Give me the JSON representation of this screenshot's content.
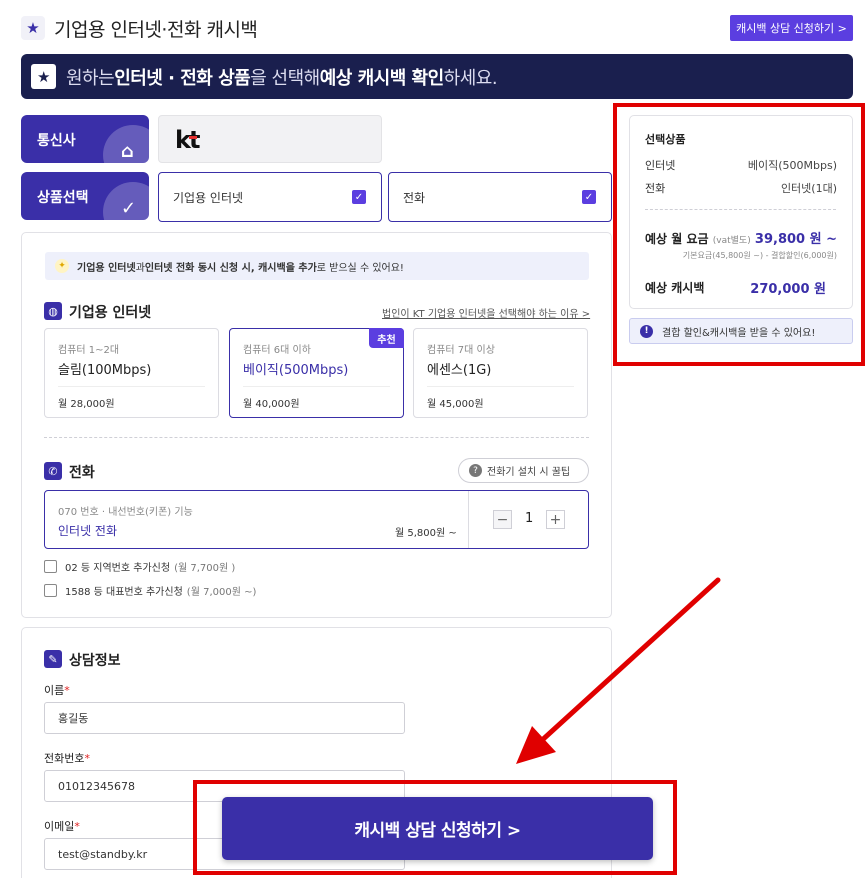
{
  "header": {
    "title": "기업용 인터넷·전화 캐시백",
    "consult_button": "캐시백 상담 신청하기 >"
  },
  "banner": {
    "part1": "원하는 ",
    "part2": "인터넷 · 전화 상품",
    "part3": "을 선택해 ",
    "part4": "예상 캐시백 확인",
    "part5": "하세요."
  },
  "carrier": {
    "label": "통신사",
    "value": "kt"
  },
  "product_select": {
    "label": "상품선택",
    "options": [
      {
        "label": "기업용 인터넷",
        "checked": true
      },
      {
        "label": "전화",
        "checked": true
      }
    ]
  },
  "tip": {
    "b1": "기업용 인터넷",
    "t1": "과 ",
    "b2": "인터넷 전화 동시 신청 시, 캐시백을 추가",
    "t2": "로 받으실 수 있어요!"
  },
  "internet": {
    "title": "기업용 인터넷",
    "link": "법인이 KT 기업용 인터넷을 선택해야 하는 이유 >",
    "plans": [
      {
        "sub": "컴퓨터 1~2대",
        "name": "슬림(100Mbps)",
        "price": "월 28,000원",
        "selected": false
      },
      {
        "sub": "컴퓨터 6대 이하",
        "name": "베이직(500Mbps)",
        "price": "월 40,000원",
        "selected": true,
        "badge": "추천"
      },
      {
        "sub": "컴퓨터 7대 이상",
        "name": "에센스(1G)",
        "price": "월 45,000원",
        "selected": false
      }
    ]
  },
  "phone": {
    "title": "전화",
    "tips_button": "전화기 설치 시 꿀팁",
    "item_sub": "070 번호 · 내선번호(키폰) 기능",
    "item_name": "인터넷 전화",
    "item_price": "월 5,800원 ~",
    "quantity": "1",
    "addons": [
      {
        "label": "02 등 지역번호 추가신청",
        "price": "(월 7,700원 )",
        "checked": false
      },
      {
        "label": "1588 등 대표번호 추가신청",
        "price": "(월 7,000원 ~)",
        "checked": false
      }
    ]
  },
  "consult": {
    "title": "상담정보",
    "name_label": "이름",
    "name_value": "홍길동",
    "phone_label": "전화번호",
    "phone_value": "01012345678",
    "email_label": "이메일",
    "email_value": "test@standby.kr",
    "required_mark": "*"
  },
  "summary": {
    "title": "선택상품",
    "rows": [
      {
        "label": "인터넷",
        "value": "베이직(500Mbps)"
      },
      {
        "label": "전화",
        "value": "인터넷(1대)"
      }
    ],
    "monthly_label": "예상 월 요금",
    "monthly_note": "(vat별도)",
    "monthly_value": "39,800 원 ~",
    "monthly_detail": "기본요금(45,800원 ~) - 결합할인(6,000원)",
    "cashback_label": "예상 캐시백",
    "cashback_value": "270,000 원",
    "notice": "결합 할인&캐시백을 받을 수 있어요!"
  },
  "cta": {
    "label": "캐시백 상담 신청하기 >"
  },
  "colors": {
    "primary": "#3a2fa8",
    "accent": "#5b3ee0",
    "banner_bg": "#1a1f4e",
    "annotation_red": "#e00000"
  }
}
